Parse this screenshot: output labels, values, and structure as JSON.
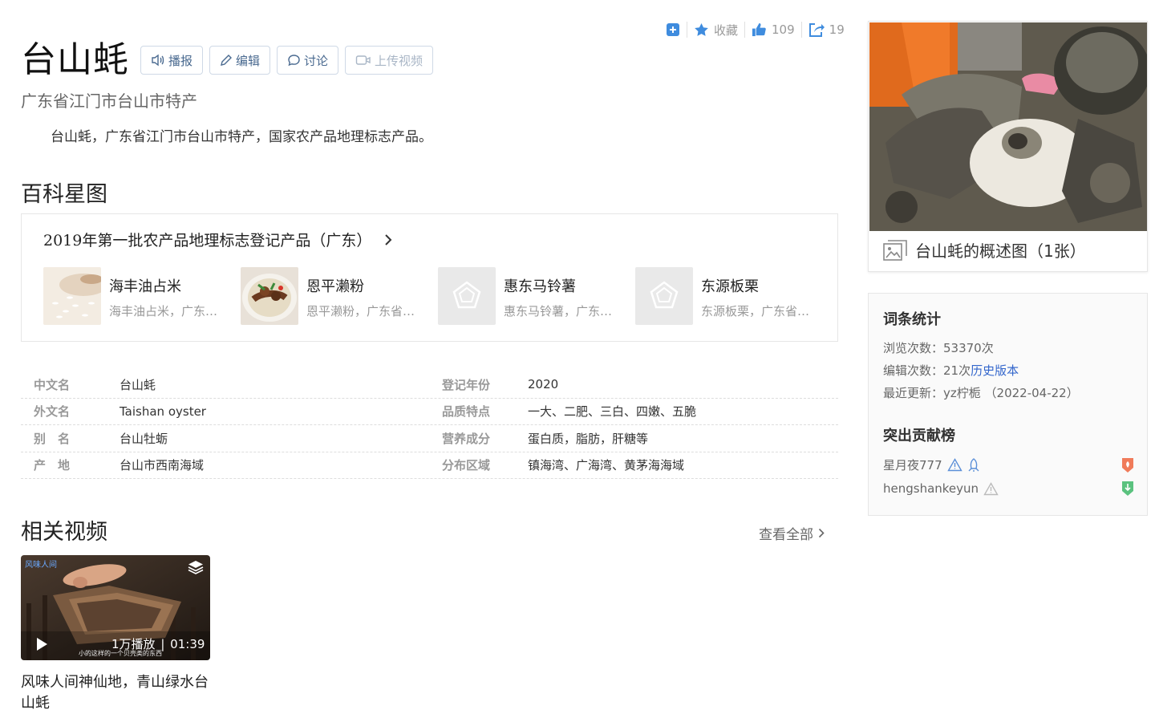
{
  "toolbar": {
    "favorite_label": "收藏",
    "like_count": "109",
    "share_count": "19"
  },
  "entry": {
    "title": "台山蚝",
    "subtitle": "广东省江门市台山市特产",
    "summary": "台山蚝，广东省江门市台山市特产，国家农产品地理标志产品。"
  },
  "title_buttons": {
    "play": "播报",
    "edit": "编辑",
    "discuss": "讨论",
    "upload_video": "上传视频"
  },
  "star_map": {
    "section_title": "百科星图",
    "card_title": "2019年第一批农产品地理标志登记产品（广东）",
    "items": [
      {
        "name": "海丰油占米",
        "desc": "海丰油占米，广东…"
      },
      {
        "name": "恩平濑粉",
        "desc": "恩平濑粉，广东省…"
      },
      {
        "name": "惠东马铃薯",
        "desc": "惠东马铃薯，广东…"
      },
      {
        "name": "东源板栗",
        "desc": "东源板栗，广东省…"
      }
    ]
  },
  "info_box": {
    "rows": [
      {
        "k1": "中文名",
        "v1": "台山蚝",
        "k2": "登记年份",
        "v2": "2020"
      },
      {
        "k1": "外文名",
        "v1": "Taishan oyster",
        "k2": "品质特点",
        "v2": "一大、二肥、三白、四嫩、五脆"
      },
      {
        "k1": "别　名",
        "v1": "台山牡蛎",
        "k2": "营养成分",
        "v2": "蛋白质，脂肪，肝糖等"
      },
      {
        "k1": "产　地",
        "v1": "台山市西南海域",
        "k2": "分布区域",
        "v2": "镇海湾、广海湾、黄茅海海域"
      }
    ]
  },
  "related_videos": {
    "section_title": "相关视频",
    "view_all": "查看全部",
    "videos": [
      {
        "plays": "1万播放",
        "duration": "01:39",
        "title": "风味人间神仙地，青山绿水台山蚝",
        "overlay_top": "风味人间",
        "overlay_caption": "小的这样的一个贝壳类的东西"
      }
    ]
  },
  "album": {
    "caption": "台山蚝的概述图（1张）"
  },
  "stats": {
    "title": "词条统计",
    "views": "浏览次数：53370次",
    "edits_prefix": "编辑次数：21次",
    "history_link": "历史版本",
    "last_update": "最近更新：yz柠栀 （2022-04-22）",
    "contributors_title": "突出贡献榜",
    "contributors": [
      {
        "name": "星月夜777",
        "rank_color": "#f07b5a"
      },
      {
        "name": "hengshankeyun",
        "rank_color": "#5bc27f"
      }
    ]
  },
  "colors": {
    "accent_blue": "#3f8cde",
    "link": "#3366cc",
    "button_border": "#cfd9e6"
  }
}
